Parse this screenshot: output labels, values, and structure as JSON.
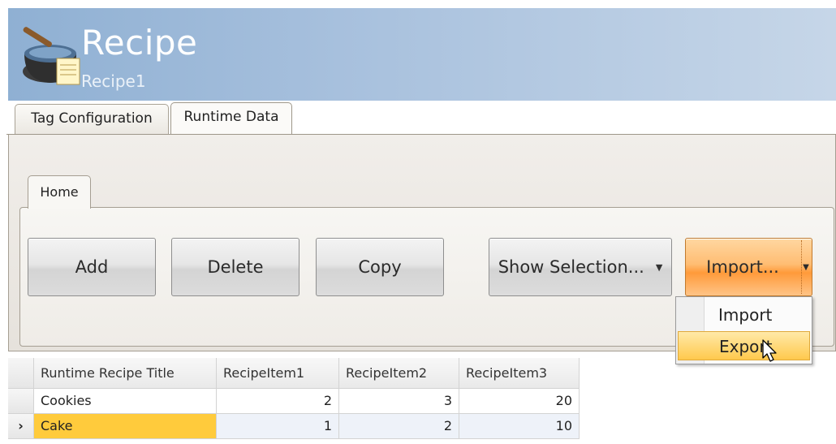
{
  "header": {
    "title": "Recipe",
    "subtitle": "Recipe1",
    "icon": "recipe-pot-icon",
    "gradient_colors": [
      "#8fb0d3",
      "#c6d6e8"
    ]
  },
  "outer_tabs": [
    {
      "label": "Tag Configuration",
      "active": false
    },
    {
      "label": "Runtime Data",
      "active": true
    }
  ],
  "ribbon": {
    "tab_label": "Home",
    "buttons": {
      "add": "Add",
      "delete": "Delete",
      "copy": "Copy",
      "show_selection": "Show Selection...",
      "import": "Import..."
    },
    "hot_color": "#ff9a3a"
  },
  "dropdown": {
    "items": [
      "Import",
      "Export"
    ],
    "highlighted": "Export"
  },
  "grid": {
    "columns": [
      "Runtime Recipe Title",
      "RecipeItem1",
      "RecipeItem2",
      "RecipeItem3"
    ],
    "rows": [
      {
        "title": "Cookies",
        "item1": "2",
        "item2": "3",
        "item3": "20",
        "current": false
      },
      {
        "title": "Cake",
        "item1": "1",
        "item2": "2",
        "item3": "10",
        "current": true
      }
    ],
    "current_row_marker": "›",
    "selection_color": "#ffcb3c"
  }
}
